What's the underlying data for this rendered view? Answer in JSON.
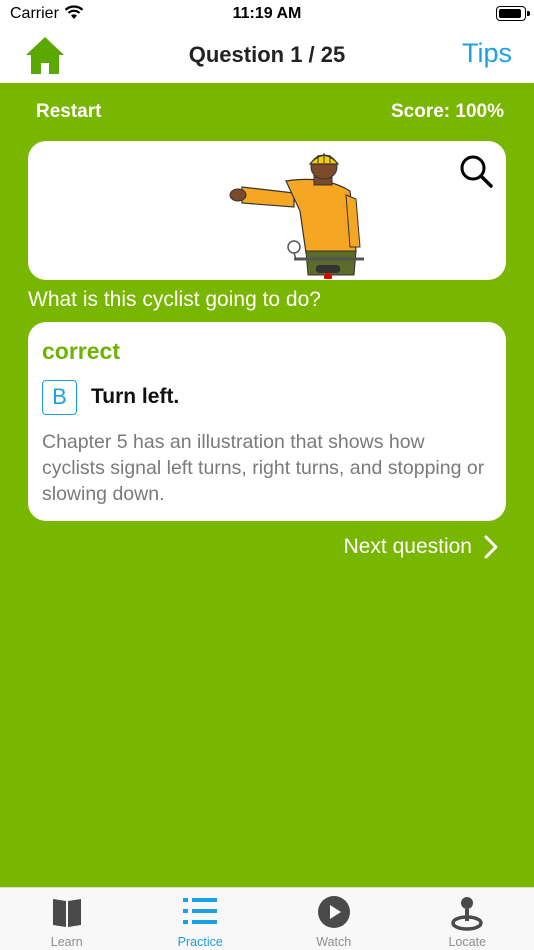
{
  "status_bar": {
    "carrier": "Carrier",
    "time": "11:19 AM"
  },
  "nav": {
    "title": "Question 1 / 25",
    "tips_label": "Tips",
    "home_icon": "home-icon"
  },
  "quiz": {
    "restart_label": "Restart",
    "score_label": "Score: 100%",
    "question": "What is this cyclist going to do?",
    "result_label": "correct",
    "answer_letter": "B",
    "answer_text": "Turn left.",
    "explanation": "Chapter 5 has an illustration that shows how cyclists signal left turns, right turns, and stopping or slowing down.",
    "next_label": "Next question"
  },
  "tabs": [
    {
      "label": "Learn",
      "icon": "book-icon",
      "active": false
    },
    {
      "label": "Practice",
      "icon": "list-icon",
      "active": true
    },
    {
      "label": "Watch",
      "icon": "play-icon",
      "active": false
    },
    {
      "label": "Locate",
      "icon": "location-icon",
      "active": false
    }
  ],
  "colors": {
    "background": "#78b600",
    "accent_blue": "#1ba1e2",
    "correct_green": "#6fb300",
    "home_green": "#5aa800"
  }
}
